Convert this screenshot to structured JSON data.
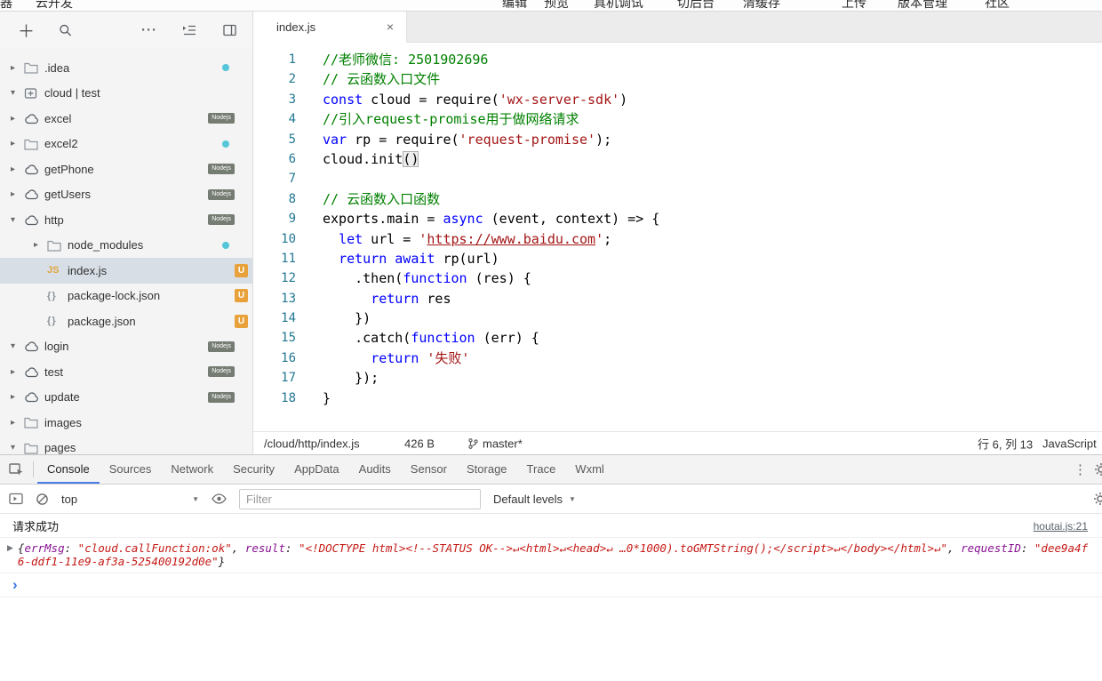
{
  "colors": {
    "accent": "#4a7de8",
    "keyword": "#0000ff",
    "string": "#a31515",
    "comment": "#008000",
    "line_number": "#237893",
    "badge_modified": "#e9a23b",
    "folder_dot": "#55c6d8",
    "console_key": "#881391",
    "console_string": "#c41a16"
  },
  "menubar": {
    "left_items": [
      "器",
      "云开发"
    ],
    "right_items": [
      "编辑",
      "预览",
      "真机调试",
      "切后台",
      "清缓存",
      "上传",
      "版本管理",
      "社区"
    ]
  },
  "sidebar": {
    "tree": [
      {
        "label": ".idea",
        "icon": "folder-icon",
        "arrow": "collapsed",
        "badge": "dot",
        "indent": 0
      },
      {
        "label": "cloud | test",
        "icon": "cloud-root-icon",
        "arrow": "expanded",
        "badge": "",
        "indent": 0
      },
      {
        "label": "excel",
        "icon": "cloud-fn-icon",
        "arrow": "collapsed",
        "badge": "Nodejs",
        "indent": 0
      },
      {
        "label": "excel2",
        "icon": "folder-icon",
        "arrow": "collapsed",
        "badge": "dot",
        "indent": 0
      },
      {
        "label": "getPhone",
        "icon": "cloud-fn-icon",
        "arrow": "collapsed",
        "badge": "Nodejs",
        "indent": 0
      },
      {
        "label": "getUsers",
        "icon": "cloud-fn-icon",
        "arrow": "collapsed",
        "badge": "Nodejs",
        "indent": 0
      },
      {
        "label": "http",
        "icon": "cloud-fn-icon",
        "arrow": "expanded",
        "badge": "Nodejs",
        "indent": 0
      },
      {
        "label": "node_modules",
        "icon": "folder-icon",
        "arrow": "collapsed",
        "badge": "dot",
        "indent": 1
      },
      {
        "label": "index.js",
        "icon": "js-icon",
        "arrow": "none",
        "badge": "U",
        "indent": 1,
        "selected": true
      },
      {
        "label": "package-lock.json",
        "icon": "json-icon",
        "arrow": "none",
        "badge": "U",
        "indent": 1
      },
      {
        "label": "package.json",
        "icon": "json-icon",
        "arrow": "none",
        "badge": "U",
        "indent": 1
      },
      {
        "label": "login",
        "icon": "cloud-fn-icon",
        "arrow": "expanded",
        "badge": "Nodejs",
        "indent": 0
      },
      {
        "label": "test",
        "icon": "cloud-fn-icon",
        "arrow": "collapsed",
        "badge": "Nodejs",
        "indent": 0
      },
      {
        "label": "update",
        "icon": "cloud-fn-icon",
        "arrow": "collapsed",
        "badge": "Nodejs",
        "indent": 0
      },
      {
        "label": "images",
        "icon": "folder-icon",
        "arrow": "collapsed",
        "badge": "",
        "indent": 0
      },
      {
        "label": "pages",
        "icon": "folder-icon",
        "arrow": "expanded",
        "badge": "",
        "indent": 0
      }
    ]
  },
  "editor": {
    "tab": {
      "label": "index.js",
      "close": "×"
    },
    "code_lines": [
      {
        "n": 1,
        "tokens": [
          {
            "t": "//老师微信: 2501902696",
            "c": "cm"
          }
        ]
      },
      {
        "n": 2,
        "tokens": [
          {
            "t": "// 云函数入口文件",
            "c": "cm"
          }
        ]
      },
      {
        "n": 3,
        "tokens": [
          {
            "t": "const",
            "c": "kw"
          },
          {
            "t": " cloud = require(",
            "c": ""
          },
          {
            "t": "'wx-server-sdk'",
            "c": "str"
          },
          {
            "t": ")",
            "c": ""
          }
        ]
      },
      {
        "n": 4,
        "tokens": [
          {
            "t": "//引入request-promise用于做网络请求",
            "c": "cm"
          }
        ]
      },
      {
        "n": 5,
        "tokens": [
          {
            "t": "var",
            "c": "kw"
          },
          {
            "t": " rp = require(",
            "c": ""
          },
          {
            "t": "'request-promise'",
            "c": "str"
          },
          {
            "t": ");",
            "c": ""
          }
        ]
      },
      {
        "n": 6,
        "tokens": [
          {
            "t": "cloud.init",
            "c": ""
          },
          {
            "t": "()",
            "c": "bm"
          }
        ]
      },
      {
        "n": 7,
        "tokens": []
      },
      {
        "n": 8,
        "tokens": [
          {
            "t": "// 云函数入口函数",
            "c": "cm"
          }
        ]
      },
      {
        "n": 9,
        "tokens": [
          {
            "t": "exports.main = ",
            "c": ""
          },
          {
            "t": "async",
            "c": "kw"
          },
          {
            "t": " (event, context) => {",
            "c": ""
          }
        ]
      },
      {
        "n": 10,
        "tokens": [
          {
            "t": "  ",
            "c": ""
          },
          {
            "t": "let",
            "c": "kw"
          },
          {
            "t": " url = ",
            "c": ""
          },
          {
            "t": "'",
            "c": "str"
          },
          {
            "t": "https://www.baidu.com",
            "c": "strlink"
          },
          {
            "t": "'",
            "c": "str"
          },
          {
            "t": ";",
            "c": ""
          }
        ]
      },
      {
        "n": 11,
        "tokens": [
          {
            "t": "  ",
            "c": ""
          },
          {
            "t": "return",
            "c": "kw"
          },
          {
            "t": " ",
            "c": ""
          },
          {
            "t": "await",
            "c": "kw"
          },
          {
            "t": " rp(url)",
            "c": ""
          }
        ]
      },
      {
        "n": 12,
        "tokens": [
          {
            "t": "    .then(",
            "c": ""
          },
          {
            "t": "function",
            "c": "kw"
          },
          {
            "t": " (res) {",
            "c": ""
          }
        ]
      },
      {
        "n": 13,
        "tokens": [
          {
            "t": "      ",
            "c": ""
          },
          {
            "t": "return",
            "c": "kw"
          },
          {
            "t": " res",
            "c": ""
          }
        ]
      },
      {
        "n": 14,
        "tokens": [
          {
            "t": "    })",
            "c": ""
          }
        ]
      },
      {
        "n": 15,
        "tokens": [
          {
            "t": "    .catch(",
            "c": ""
          },
          {
            "t": "function",
            "c": "kw"
          },
          {
            "t": " (err) {",
            "c": ""
          }
        ]
      },
      {
        "n": 16,
        "tokens": [
          {
            "t": "      ",
            "c": ""
          },
          {
            "t": "return",
            "c": "kw"
          },
          {
            "t": " ",
            "c": ""
          },
          {
            "t": "'失败'",
            "c": "str"
          }
        ]
      },
      {
        "n": 17,
        "tokens": [
          {
            "t": "    });",
            "c": ""
          }
        ]
      },
      {
        "n": 18,
        "tokens": [
          {
            "t": "}",
            "c": ""
          }
        ]
      }
    ],
    "statusbar": {
      "path": "/cloud/http/index.js",
      "size": "426 B",
      "branch": "master*",
      "cursor": "行 6, 列 13",
      "language": "JavaScript"
    }
  },
  "devtools": {
    "tabs": [
      "Console",
      "Sources",
      "Network",
      "Security",
      "AppData",
      "Audits",
      "Sensor",
      "Storage",
      "Trace",
      "Wxml"
    ],
    "active_tab": "Console",
    "toolbar": {
      "context": "top",
      "filter_placeholder": "Filter",
      "levels": "Default levels"
    },
    "console": {
      "message": "请求成功",
      "source_link": "houtai.js:21",
      "object_tokens": [
        {
          "t": "{",
          "c": "pl"
        },
        {
          "t": "errMsg",
          "c": "key"
        },
        {
          "t": ": ",
          "c": "pl"
        },
        {
          "t": "\"cloud.callFunction:ok\"",
          "c": "str"
        },
        {
          "t": ", ",
          "c": "pl"
        },
        {
          "t": "result",
          "c": "key"
        },
        {
          "t": ": ",
          "c": "pl"
        },
        {
          "t": "\"<!DOCTYPE html><!--STATUS OK-->↵<html>↵<head>↵  …0*1000).toGMTString();</script>↵</body></html>↵\"",
          "c": "str"
        },
        {
          "t": ", ",
          "c": "pl"
        },
        {
          "t": "requestID",
          "c": "key"
        },
        {
          "t": ": ",
          "c": "pl"
        },
        {
          "t": "\"dee9a4f6-ddf1-11e9-af3a-525400192d0e\"",
          "c": "str"
        },
        {
          "t": "}",
          "c": "pl"
        }
      ],
      "prompt": "›"
    }
  }
}
